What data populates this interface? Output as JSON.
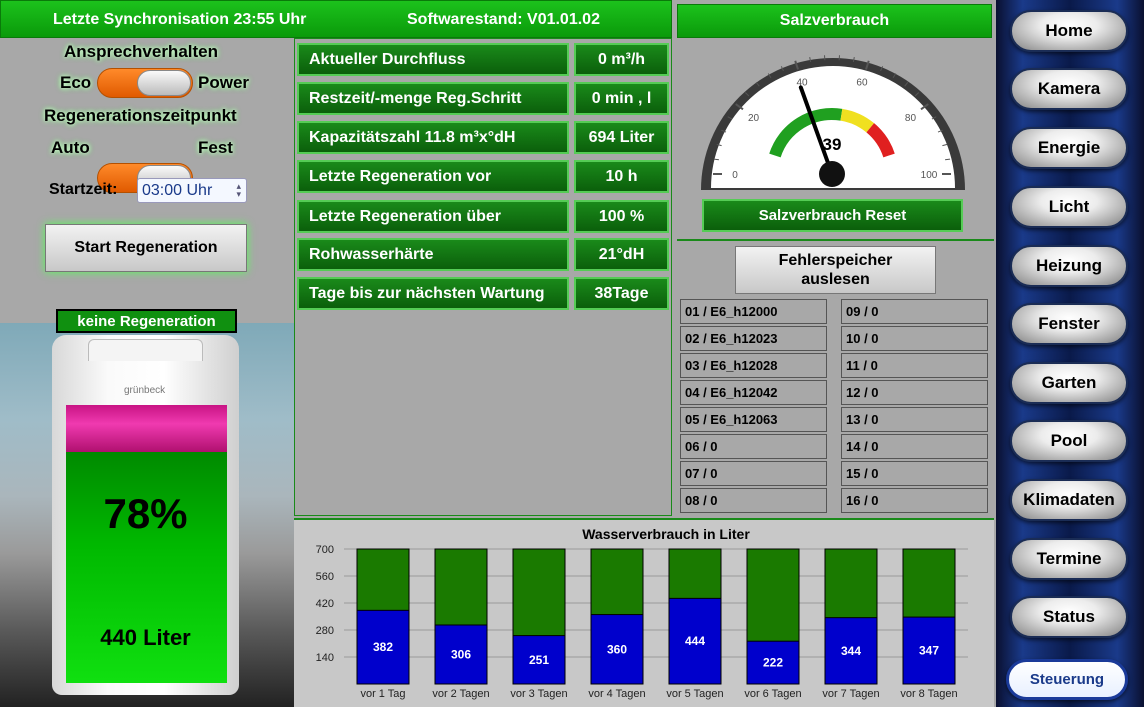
{
  "header": {
    "sync_text": "Letzte Synchronisation 23:55 Uhr",
    "software_text": "Softwarestand: V01.01.02",
    "salt_title": "Salzverbrauch"
  },
  "controls": {
    "ansprech_label": "Ansprechverhalten",
    "eco_label": "Eco",
    "power_label": "Power",
    "regenzeit_label": "Regenerationszeitpunkt",
    "auto_label": "Auto",
    "fest_label": "Fest",
    "startzeit_label": "Startzeit:",
    "startzeit_value": "03:00 Uhr",
    "start_regen_button": "Start Regeneration"
  },
  "tank": {
    "status_label": "keine Regeneration",
    "brand": "grünbeck",
    "percent": "78%",
    "fill_fraction": 0.78,
    "liters": "440 Liter"
  },
  "metrics": [
    {
      "label": "Aktueller Durchfluss",
      "value": "0 m³/h"
    },
    {
      "label": "Restzeit/-menge Reg.Schritt",
      "value": "0 min , l"
    },
    {
      "label": "Kapazitätszahl 11.8 m³x°dH",
      "value": "694 Liter"
    },
    {
      "label": "Letzte Regeneration vor",
      "value": "10 h"
    },
    {
      "label": "Letzte Regeneration über",
      "value": "100 %"
    },
    {
      "label": "Rohwasserhärte",
      "value": "21°dH"
    },
    {
      "label": "Tage bis zur nächsten Wartung",
      "value": "38Tage"
    }
  ],
  "gauge": {
    "value": 39,
    "value_text": "39",
    "min": 0,
    "max": 100,
    "ticks": [
      "0",
      "20",
      "40",
      "60",
      "80",
      "100"
    ],
    "reset_button": "Salzverbrauch Reset"
  },
  "errors": {
    "read_button": "Fehlerspeicher auslesen",
    "left": [
      "01 / E6_h12000",
      "02 / E6_h12023",
      "03 / E6_h12028",
      "04 / E6_h12042",
      "05 / E6_h12063",
      "06 / 0",
      "07 / 0",
      "08 / 0"
    ],
    "right": [
      "09 / 0",
      "10 / 0",
      "11 / 0",
      "12 / 0",
      "13 / 0",
      "14 / 0",
      "15 / 0",
      "16 / 0"
    ]
  },
  "nav": {
    "items": [
      "Home",
      "Kamera",
      "Energie",
      "Licht",
      "Heizung",
      "Fenster",
      "Garten",
      "Pool",
      "Klimadaten",
      "Termine",
      "Status"
    ],
    "active": "Steuerung"
  },
  "colors": {
    "green": "#1cc21c",
    "usage_bar": "#0000cc",
    "capacity_bar": "#1a7a00",
    "salt_level": "#e0209a",
    "water_level": "#00cc00",
    "nav_active_border": "#1a3a99"
  },
  "chart_data": {
    "type": "bar",
    "title": "Wasserverbrauch in Liter",
    "categories": [
      "vor 1 Tag",
      "vor 2 Tagen",
      "vor 3 Tagen",
      "vor 4 Tagen",
      "vor 5 Tagen",
      "vor 6 Tagen",
      "vor 7 Tagen",
      "vor 8 Tagen"
    ],
    "series": [
      {
        "values": [
          382,
          306,
          251,
          360,
          444,
          222,
          344,
          347
        ]
      }
    ],
    "ylim": [
      0,
      700
    ],
    "yticks": [
      140,
      280,
      420,
      560,
      700
    ],
    "grid": true,
    "capacity": 700
  }
}
